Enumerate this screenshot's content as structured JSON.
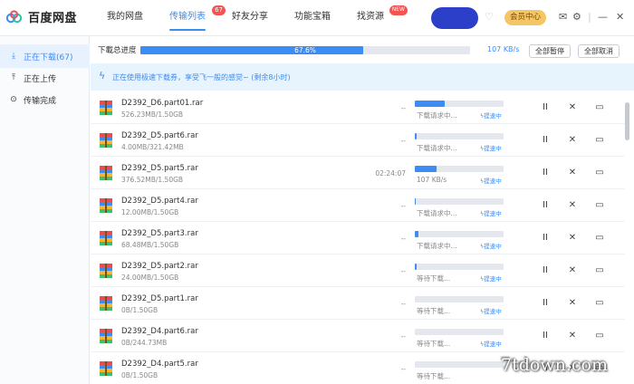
{
  "app": {
    "title": "百度网盘"
  },
  "nav": [
    {
      "label": "我的网盘",
      "badge": ""
    },
    {
      "label": "传输列表",
      "badge": "67"
    },
    {
      "label": "好友分享",
      "badge": ""
    },
    {
      "label": "功能宝箱",
      "badge": ""
    },
    {
      "label": "找资源",
      "badge": "NEW"
    }
  ],
  "topright": {
    "vip_label": "会员中心"
  },
  "sidebar": {
    "items": [
      {
        "label": "正在下载(67)",
        "icon": "download-icon"
      },
      {
        "label": "正在上传",
        "icon": "upload-icon"
      },
      {
        "label": "传输完成",
        "icon": "check-circle-icon"
      }
    ]
  },
  "progress": {
    "label": "下載总进度",
    "percent_text": "67.6%",
    "percent": 67.6,
    "speed": "107 KB/s",
    "pause_all": "全部暂停",
    "cancel_all": "全部取消"
  },
  "banner": {
    "text": "正在使用极速下载券，享受飞一般的感觉~ (剩余8小时)"
  },
  "accel_label": "提速中",
  "files": [
    {
      "name": "D2392_D6.part01.rar",
      "size": "526.23MB/1.50GB",
      "time": "--",
      "progress": 34,
      "status": "下载请求中...",
      "accel": true
    },
    {
      "name": "D2392_D5.part6.rar",
      "size": "4.00MB/321.42MB",
      "time": "--",
      "progress": 2,
      "status": "下载请求中...",
      "accel": true
    },
    {
      "name": "D2392_D5.part5.rar",
      "size": "376.52MB/1.50GB",
      "time": "02:24:07",
      "progress": 24,
      "status": "107 KB/s",
      "accel": true
    },
    {
      "name": "D2392_D5.part4.rar",
      "size": "12.00MB/1.50GB",
      "time": "--",
      "progress": 1,
      "status": "下载请求中...",
      "accel": true
    },
    {
      "name": "D2392_D5.part3.rar",
      "size": "68.48MB/1.50GB",
      "time": "--",
      "progress": 4,
      "status": "下载请求中...",
      "accel": true
    },
    {
      "name": "D2392_D5.part2.rar",
      "size": "24.00MB/1.50GB",
      "time": "--",
      "progress": 2,
      "status": "等待下载...",
      "accel": true
    },
    {
      "name": "D2392_D5.part1.rar",
      "size": "0B/1.50GB",
      "time": "--",
      "progress": 0,
      "status": "等待下载...",
      "accel": true
    },
    {
      "name": "D2392_D4.part6.rar",
      "size": "0B/244.73MB",
      "time": "--",
      "progress": 0,
      "status": "等待下载...",
      "accel": true
    },
    {
      "name": "D2392_D4.part5.rar",
      "size": "0B/1.50GB",
      "time": "--",
      "progress": 0,
      "status": "等待下载...",
      "accel": false
    }
  ],
  "watermark": "7tdown.com"
}
